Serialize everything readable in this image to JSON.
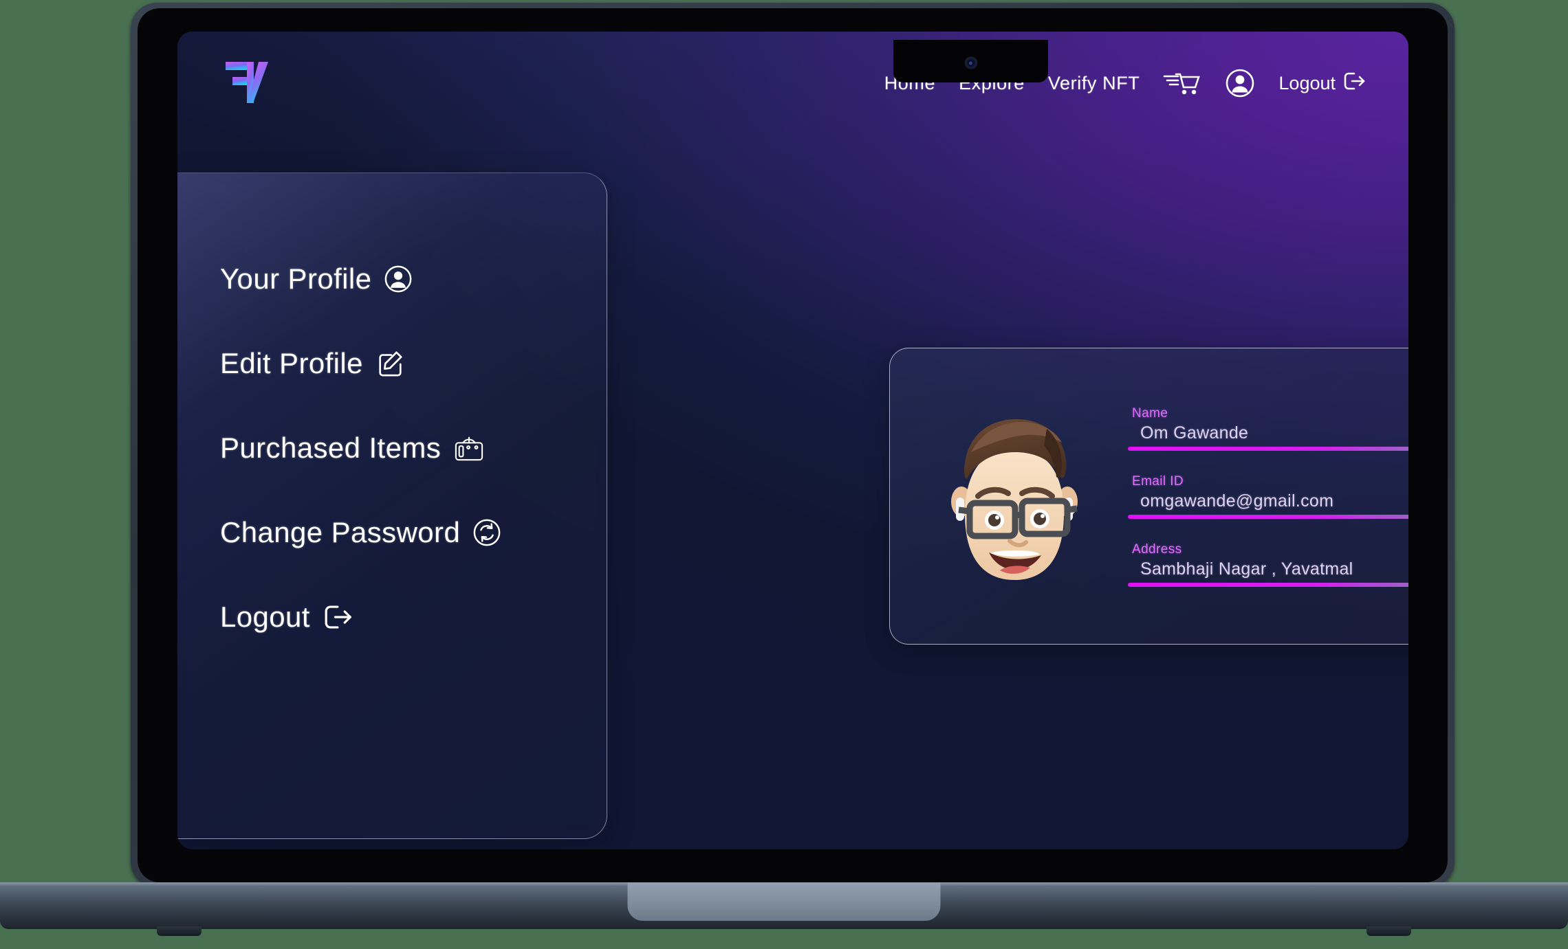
{
  "brand": {
    "logo_alt": "FV logo",
    "colors": {
      "logo_start": "#c45cf5",
      "logo_end": "#21c8f6"
    }
  },
  "header": {
    "nav_links": [
      {
        "label": "Home"
      },
      {
        "label": "Explore"
      },
      {
        "label": "Verify NFT"
      }
    ],
    "cart_icon": "shopping-cart-icon",
    "account_icon": "user-circle-icon",
    "logout": {
      "label": "Logout",
      "icon": "sign-out-icon"
    }
  },
  "sidebar": {
    "items": [
      {
        "label": "Your Profile",
        "icon": "user-circle-icon"
      },
      {
        "label": "Edit Profile",
        "icon": "edit-pencil-square-icon"
      },
      {
        "label": "Purchased Items",
        "icon": "briefcase-bag-icon"
      },
      {
        "label": "Change Password",
        "icon": "refresh-circle-icon"
      },
      {
        "label": "Logout",
        "icon": "sign-out-icon"
      }
    ]
  },
  "profile_card": {
    "avatar": "memoji-avatar",
    "fields": [
      {
        "label": "Name",
        "value": "Om Gawande"
      },
      {
        "label": "Email ID",
        "value": "omgawande@gmail.com"
      },
      {
        "label": "Address",
        "value": "Sambhaji Nagar , Yavatmal"
      }
    ],
    "accent_color": "#e011f5",
    "label_color": "#e06bff"
  }
}
